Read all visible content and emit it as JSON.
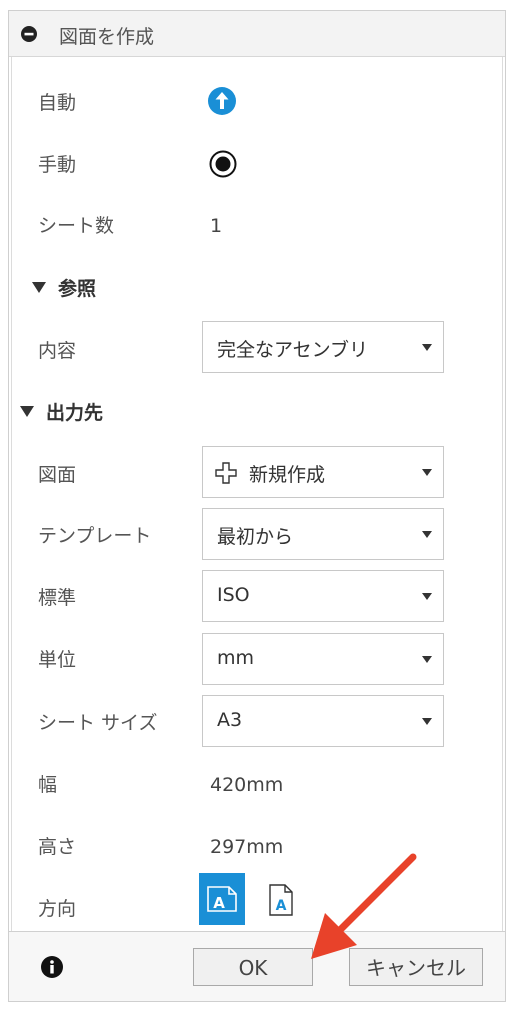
{
  "header": {
    "title": "図面を作成"
  },
  "rows": {
    "auto_label": "自動",
    "manual_label": "手動",
    "sheet_count_label": "シート数",
    "sheet_count_value": "1",
    "content_label": "内容",
    "drawing_label": "図面",
    "template_label": "テンプレート",
    "standard_label": "標準",
    "unit_label": "単位",
    "sheet_size_label": "シート サイズ",
    "width_label": "幅",
    "width_value": "420mm",
    "height_label": "高さ",
    "height_value": "297mm",
    "orientation_label": "方向"
  },
  "sections": {
    "reference": "参照",
    "output": "出力先"
  },
  "selects": {
    "content": "完全なアセンブリ",
    "drawing": "新規作成",
    "template": "最初から",
    "standard": "ISO",
    "unit": "mm",
    "sheet_size": "A3"
  },
  "orientation": {
    "landscape_glyph": "A",
    "portrait_glyph": "A",
    "selected": "landscape"
  },
  "footer": {
    "ok_label": "OK",
    "cancel_label": "キャンセル"
  },
  "colors": {
    "accent": "#1a8fd6",
    "arrow": "#e8422a"
  }
}
